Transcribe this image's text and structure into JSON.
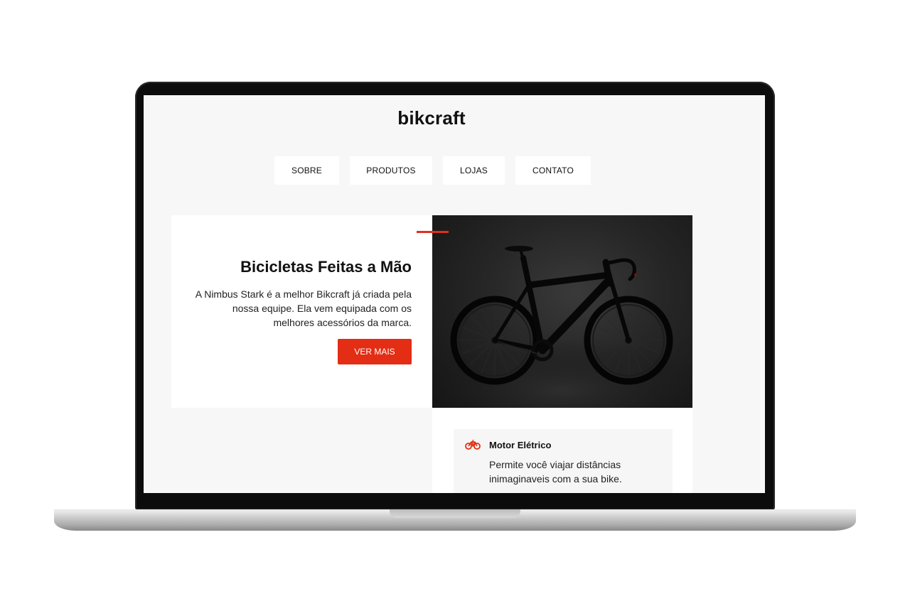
{
  "site": {
    "logo": "bikcraft"
  },
  "nav": {
    "items": [
      {
        "label": "SOBRE"
      },
      {
        "label": "PRODUTOS"
      },
      {
        "label": "LOJAS"
      },
      {
        "label": "CONTATO"
      }
    ]
  },
  "hero": {
    "title": "Bicicletas Feitas a Mão",
    "description": "A Nimbus Stark é a melhor Bikcraft já criada pela nossa equipe. Ela vem equipada com os melhores acessórios da marca.",
    "button_label": "VER MAIS",
    "image_icon": "bicycle-photo"
  },
  "features": [
    {
      "icon": "electric-bike-icon",
      "title": "Motor Elétrico",
      "description": "Permite você viajar distâncias inimaginaveis com a sua bike."
    }
  ],
  "colors": {
    "accent": "#e32d14",
    "page_background": "#f7f7f7",
    "card_background": "#ffffff"
  }
}
